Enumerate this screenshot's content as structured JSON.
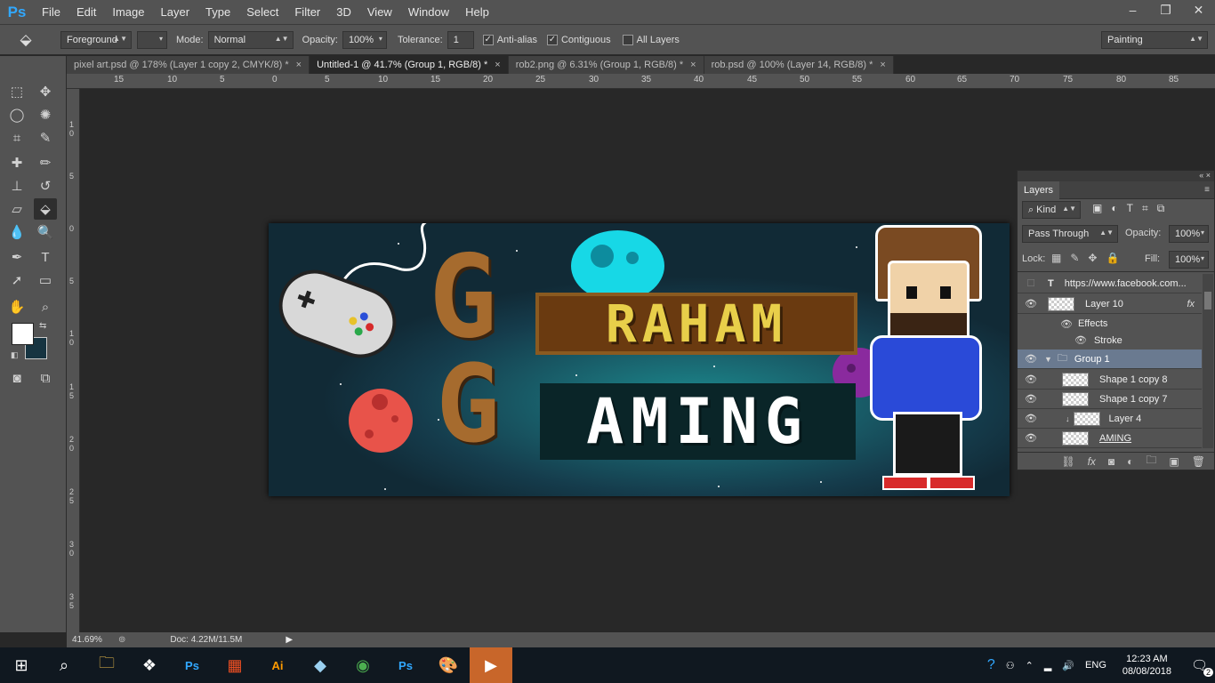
{
  "app": {
    "logo": "Ps"
  },
  "menu": [
    "File",
    "Edit",
    "Image",
    "Layer",
    "Type",
    "Select",
    "Filter",
    "3D",
    "View",
    "Window",
    "Help"
  ],
  "window_controls": {
    "minimize": "–",
    "restore": "❐",
    "close": "✕"
  },
  "options": {
    "fill_source": "Foreground",
    "mode_label": "Mode:",
    "mode_value": "Normal",
    "opacity_label": "Opacity:",
    "opacity_value": "100%",
    "tolerance_label": "Tolerance:",
    "tolerance_value": "1",
    "antialias_label": "Anti-alias",
    "contiguous_label": "Contiguous",
    "all_layers_label": "All Layers",
    "workspace": "Painting"
  },
  "tabs": [
    {
      "label": "pixel art.psd @ 178% (Layer 1 copy 2, CMYK/8) *",
      "active": false
    },
    {
      "label": "Untitled-1 @ 41.7% (Group 1, RGB/8) *",
      "active": true
    },
    {
      "label": "rob2.png @ 6.31% (Group 1, RGB/8) *",
      "active": false
    },
    {
      "label": "rob.psd @ 100% (Layer 14, RGB/8) *",
      "active": false
    }
  ],
  "ruler_top": [
    "15",
    "10",
    "5",
    "0",
    "5",
    "10",
    "15",
    "20",
    "25",
    "30",
    "35",
    "40",
    "45",
    "50",
    "55",
    "60",
    "65",
    "70",
    "75",
    "80",
    "85"
  ],
  "ruler_left": [
    "1\n0",
    "5",
    "0",
    "5",
    "1\n0",
    "1\n5",
    "2\n0",
    "2\n5",
    "3\n0",
    "3\n5"
  ],
  "canvas": {
    "word1": "RAHAM",
    "word2": "AMING",
    "big_letter": "G"
  },
  "status": {
    "zoom": "41.69%",
    "doc": "Doc: 4.22M/11.5M"
  },
  "layers_panel": {
    "tab": "Layers",
    "kind": "Kind",
    "blend": "Pass Through",
    "opacity_label": "Opacity:",
    "opacity_value": "100%",
    "lock_label": "Lock:",
    "fill_label": "Fill:",
    "fill_value": "100%",
    "rows": [
      {
        "name": "https://www.facebook.com...",
        "type": "text"
      },
      {
        "name": "Layer 10",
        "type": "layer",
        "fx": "fx"
      },
      {
        "name": "Effects",
        "type": "effects"
      },
      {
        "name": "Stroke",
        "type": "effect"
      },
      {
        "name": "Group 1",
        "type": "group"
      },
      {
        "name": "Shape 1 copy 8",
        "type": "layer"
      },
      {
        "name": "Shape 1 copy 7",
        "type": "layer"
      },
      {
        "name": "Layer 4",
        "type": "layer"
      },
      {
        "name": "AMING",
        "type": "layer"
      }
    ]
  },
  "taskbar": {
    "time": "12:23 AM",
    "date": "08/08/2018",
    "lang": "ENG",
    "notifications": "2",
    "icons": [
      "windows-start",
      "search",
      "file-explorer",
      "dropbox",
      "photoshop",
      "store",
      "illustrator",
      "app-blue",
      "chrome",
      "photoshop-active",
      "paint",
      "video-editor"
    ]
  }
}
